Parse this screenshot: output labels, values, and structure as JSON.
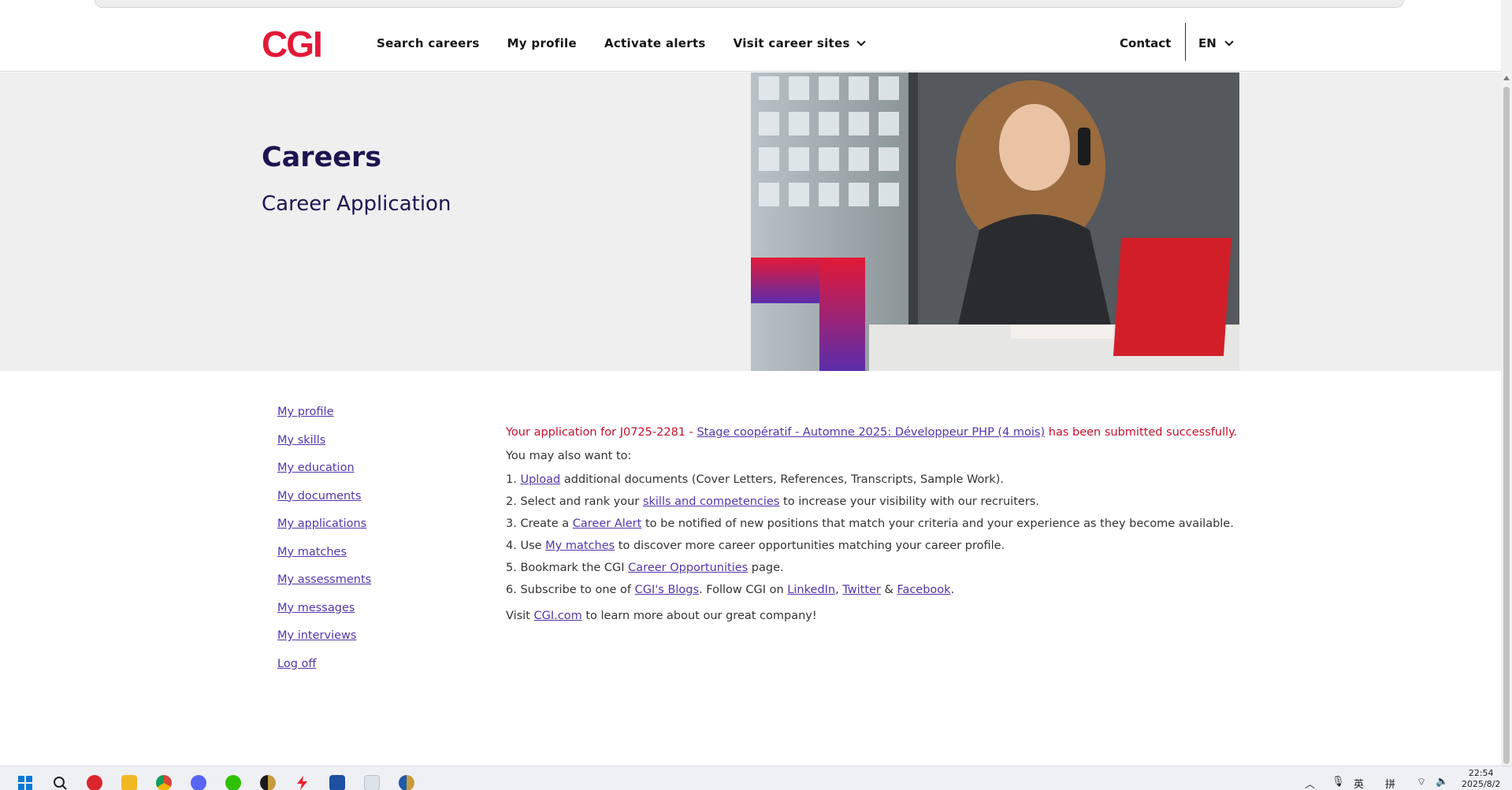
{
  "header": {
    "logo_text": "CGI",
    "nav": [
      "Search careers",
      "My profile",
      "Activate alerts",
      "Visit career sites"
    ],
    "contact_label": "Contact",
    "language_label": "EN"
  },
  "hero": {
    "title": "Careers",
    "subtitle": "Career Application"
  },
  "sidebar": {
    "links": [
      "My profile",
      "My skills",
      "My education",
      "My documents",
      "My applications",
      "My matches",
      "My assessments",
      "My messages",
      "My interviews",
      "Log off"
    ]
  },
  "content": {
    "success_prefix": "Your application for J0725-2281 - ",
    "job_link": "Stage coopératif - Automne 2025: Développeur PHP (4 mois)",
    "success_suffix": " has been submitted successfully.",
    "intro": "You may also want to:",
    "steps": [
      {
        "num": "1. ",
        "link": "Upload",
        "text": " additional documents (Cover Letters, References, Transcripts, Sample Work)."
      },
      {
        "num": "2. ",
        "pre": "Select and rank your ",
        "link": "skills and competencies",
        "text": " to increase your visibility with our recruiters."
      },
      {
        "num": "3. ",
        "pre": "Create a ",
        "link": "Career Alert",
        "text": " to be notified of new positions that match your criteria and your experience as they become available."
      },
      {
        "num": "4. ",
        "pre": "Use ",
        "link": "My matches",
        "text": " to discover more career opportunities matching your career profile."
      },
      {
        "num": "5. ",
        "pre": "Bookmark the CGI ",
        "link": "Career Opportunities",
        "text": " page."
      },
      {
        "num": "6. ",
        "pre": "Subscribe to one of ",
        "link": "CGI's Blogs",
        "text": ". Follow CGI on ",
        "link2": "LinkedIn",
        "sep2": ", ",
        "link3": "Twitter",
        "sep3": " & ",
        "link4": "Facebook",
        "end": "."
      }
    ],
    "visit_prefix": "Visit ",
    "visit_link": "CGI.com",
    "visit_suffix": " to learn more about our great company!"
  },
  "taskbar": {
    "tray_ime": "英",
    "tray_pinyin": "拼",
    "clock_time": "22:54",
    "clock_date": "2025/8/2"
  },
  "colors": {
    "brand_red": "#e31937",
    "brand_purple": "#5236ab",
    "hero_title": "#1e1450",
    "success_red": "#c8102e"
  }
}
